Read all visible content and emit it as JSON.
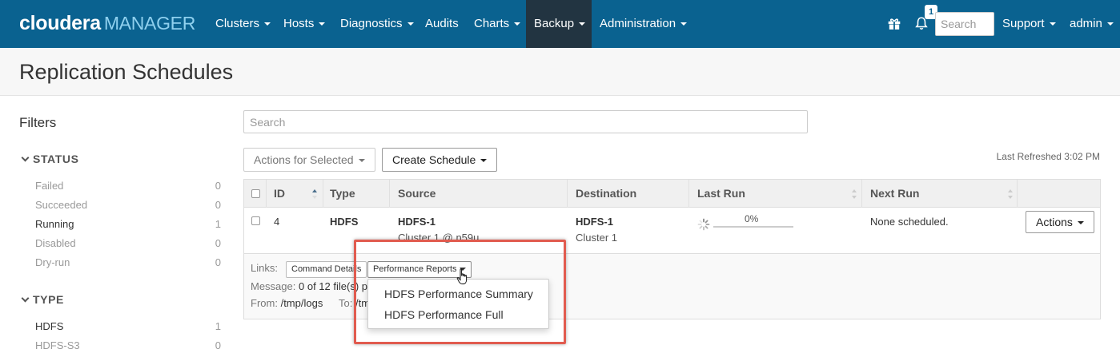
{
  "colors": {
    "nav_bg": "#0a6290",
    "nav_active": "#223441",
    "highlight": "#e15b4f"
  },
  "app": {
    "brand": "cloudera",
    "product": "MANAGER"
  },
  "nav": {
    "items": [
      "Clusters",
      "Hosts",
      "Diagnostics",
      "Audits",
      "Charts",
      "Backup",
      "Administration"
    ],
    "active": "Backup",
    "gift_icon": "gift-icon",
    "notifications_icon": "bell-icon",
    "notifications_count": "1",
    "search_placeholder": "Search",
    "support": "Support",
    "user": "admin"
  },
  "page": {
    "title": "Replication Schedules"
  },
  "filters": {
    "heading": "Filters",
    "status": {
      "label": "STATUS",
      "items": [
        {
          "name": "Failed",
          "count": "0"
        },
        {
          "name": "Succeeded",
          "count": "0"
        },
        {
          "name": "Running",
          "count": "1"
        },
        {
          "name": "Disabled",
          "count": "0"
        },
        {
          "name": "Dry-run",
          "count": "0"
        }
      ]
    },
    "type": {
      "label": "TYPE",
      "items": [
        {
          "name": "HDFS",
          "count": "1"
        },
        {
          "name": "HDFS-S3",
          "count": "0"
        }
      ]
    }
  },
  "main": {
    "search_placeholder": "Search",
    "actions_for_selected": "Actions for Selected",
    "create_schedule": "Create Schedule",
    "last_refreshed": "Last Refreshed 3:02 PM"
  },
  "table": {
    "columns": [
      "ID",
      "Type",
      "Source",
      "Destination",
      "Last Run",
      "Next Run"
    ],
    "row": {
      "id": "4",
      "type": "HDFS",
      "source": "HDFS-1",
      "source_sub": "Cluster 1 @ n59u",
      "destination": "HDFS-1",
      "destination_sub": "Cluster 1",
      "last_run_progress": "0%",
      "progress_fraction": 0,
      "next_run": "None scheduled.",
      "actions": "Actions"
    },
    "details": {
      "links_label": "Links:",
      "command_details": "Command Details",
      "performance_reports": "Performance Reports",
      "message_label": "Message:",
      "message": "0 of 12 file(s) p",
      "from_label": "From:",
      "from": "/tmp/logs",
      "to_label": "To:",
      "to": "/tm"
    }
  },
  "dropdown": {
    "items": [
      "HDFS Performance Summary",
      "HDFS Performance Full"
    ]
  }
}
